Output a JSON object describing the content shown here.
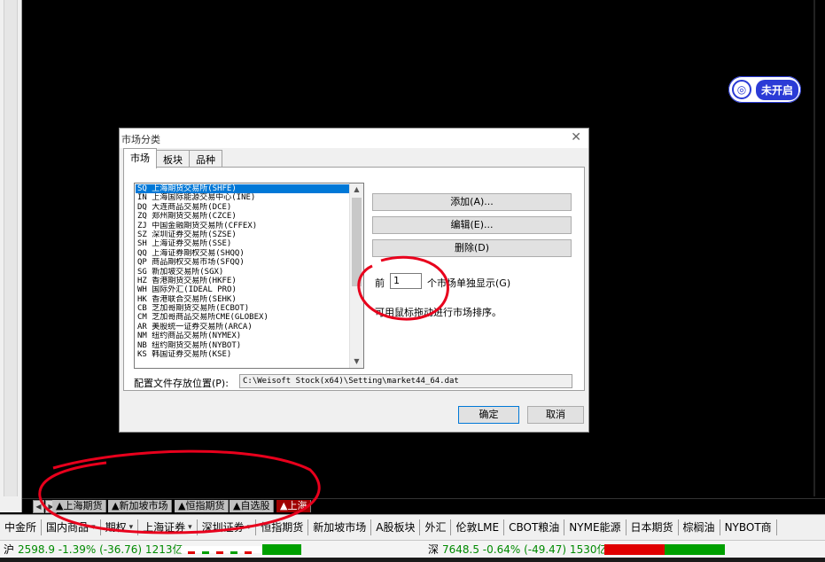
{
  "overlay_toggle": {
    "icon": "headset-icon",
    "label": "未开启"
  },
  "dialog": {
    "title": "市场分类",
    "tabs": [
      "市场",
      "板块",
      "品种"
    ],
    "list_items": [
      "SQ 上海期货交易所(SHFE)",
      "IN 上海国际能源交易中心(INE)",
      "DQ 大连商品交易所(DCE)",
      "ZQ 郑州期货交易所(CZCE)",
      "ZJ 中国金融期货交易所(CFFEX)",
      "SZ 深圳证券交易所(SZSE)",
      "SH 上海证券交易所(SSE)",
      "QQ 上海证券期权交易(SHQQ)",
      "QP 商品期权交易市场(SFQQ)",
      "SG 新加坡交易所(SGX)",
      "HZ 香港期货交易所(HKFE)",
      "WH 国际外汇(IDEAL PRO)",
      "HK 香港联合交易所(SEHK)",
      "CB 芝加哥期货交易所(ECBOT)",
      "CM 芝加哥商品交易所CME(GLOBEX)",
      "AR 美股统一证券交易所(ARCA)",
      "NM 纽约商品交易所(NYMEX)",
      "NB 纽约期货交易所(NYBOT)",
      "KS 韩国证券交易所(KSE)"
    ],
    "selected_index": 0,
    "buttons": {
      "add": "添加(A)...",
      "edit": "编辑(E)...",
      "delete": "删除(D)",
      "ok": "确定",
      "cancel": "取消"
    },
    "prefix_label": "前",
    "count_value": "1",
    "suffix_label": "个市场单独显示(G)",
    "hint": "可用鼠标拖动进行市场排序。",
    "path_label": "配置文件存放位置(P):",
    "path_value": "C:\\Weisoft Stock(x64)\\Setting\\market44_64.dat"
  },
  "sheet_tabs": [
    "▲上海期货",
    "▲新加坡市场",
    "▲恒指期货",
    "▲自选股",
    "▲上海"
  ],
  "sheet_active_index": 4,
  "market_bar": [
    {
      "label": "中金所",
      "dropdown": false
    },
    {
      "label": "国内商品",
      "dropdown": true
    },
    {
      "label": "期权",
      "dropdown": true
    },
    {
      "label": "上海证券",
      "dropdown": true
    },
    {
      "label": "深圳证券",
      "dropdown": true
    },
    {
      "label": "恒指期货",
      "dropdown": false
    },
    {
      "label": "新加坡市场",
      "dropdown": false
    },
    {
      "label": "A股板块",
      "dropdown": false
    },
    {
      "label": "外汇",
      "dropdown": false
    },
    {
      "label": "伦敦LME",
      "dropdown": false
    },
    {
      "label": "CBOT粮油",
      "dropdown": false
    },
    {
      "label": "NYME能源",
      "dropdown": false
    },
    {
      "label": "日本期货",
      "dropdown": false
    },
    {
      "label": "棕榈油",
      "dropdown": false
    },
    {
      "label": "NYBOT商",
      "dropdown": false
    }
  ],
  "status": {
    "sh_label": "沪",
    "sh_values": "2598.9 -1.39% (-36.76) 1213亿",
    "sz_label": "深",
    "sz_values": "7648.5 -0.64% (-49.47) 1530亿"
  },
  "colors": {
    "accent": "#2b3bd6",
    "selection": "#0078d7",
    "up": "#e00000",
    "down": "#008a00",
    "annotation": "#e8001c"
  }
}
